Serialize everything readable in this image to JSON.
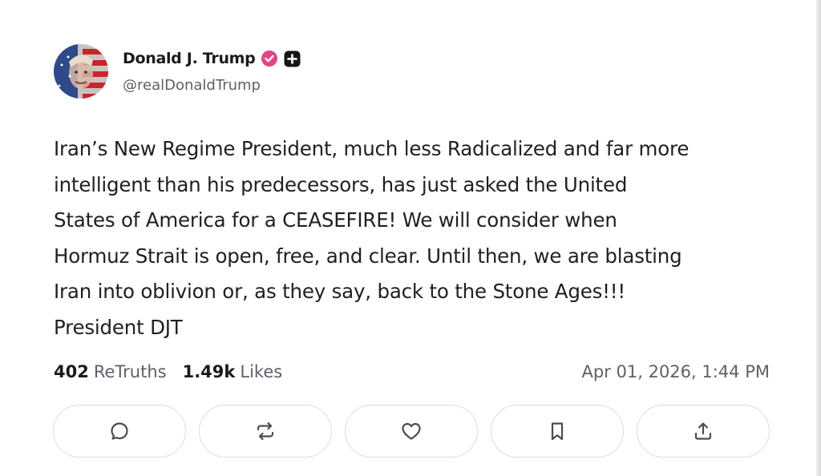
{
  "post": {
    "author": {
      "display_name": "Donald J. Trump",
      "handle": "@realDonaldTrump",
      "verified_badge_color": "#e0458a"
    },
    "body_lines": [
      "Iran’s New Regime President, much less Radicalized and far more",
      "intelligent than his predecessors, has just asked the United",
      "States of America for a CEASEFIRE! We will consider when",
      "Hormuz Strait is open, free, and clear. Until then, we are blasting",
      "Iran into oblivion or, as they say, back to the Stone Ages!!!",
      "President DJT"
    ],
    "stats": {
      "retruths_count": "402",
      "retruths_label": "ReTruths",
      "likes_count": "1.49k",
      "likes_label": "Likes"
    },
    "timestamp": "Apr 01, 2026, 1:44 PM"
  },
  "actions": [
    {
      "icon": "reply-icon"
    },
    {
      "icon": "retruth-icon"
    },
    {
      "icon": "like-icon"
    },
    {
      "icon": "bookmark-icon"
    },
    {
      "icon": "share-icon"
    }
  ],
  "colors": {
    "text": "#1b1b1f",
    "muted": "#5e6068",
    "border": "#dcdde2",
    "icon": "#4a4c55"
  }
}
